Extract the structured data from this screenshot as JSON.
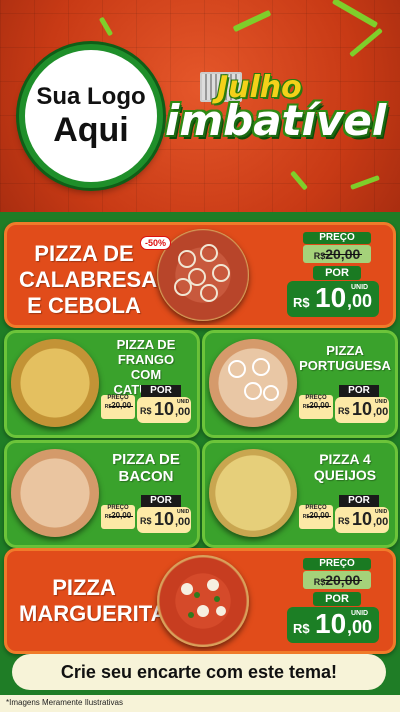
{
  "header": {
    "logo_line1": "Sua Logo",
    "logo_line2": "Aqui",
    "promo_line1": "Julho",
    "promo_line2": "imbatível"
  },
  "featured_top": {
    "name_l1": "PIZZA DE",
    "name_l2": "CALABRESA",
    "name_l3": "E CEBOLA",
    "discount": "-50%",
    "price_label": "PREÇO",
    "old_currency": "R$",
    "old_price": "20,00",
    "por_label": "POR",
    "new_currency": "R$",
    "new_price_int": "10",
    "new_price_dec": ",00",
    "unit": "UNID"
  },
  "grid": [
    {
      "name_l1": "PIZZA DE",
      "name_l2": "FRANGO COM",
      "name_l3": "CATUPIRY",
      "price_label": "PREÇO",
      "old_currency": "R$",
      "old_price": "20,00",
      "por_label": "POR",
      "new_currency": "R$",
      "new_price_int": "10",
      "new_price_dec": ",00",
      "unit": "UNID"
    },
    {
      "name_l1": "PIZZA",
      "name_l2": "PORTUGUESA",
      "name_l3": "",
      "price_label": "PREÇO",
      "old_currency": "R$",
      "old_price": "20,00",
      "por_label": "POR",
      "new_currency": "R$",
      "new_price_int": "10",
      "new_price_dec": ",00",
      "unit": "UNID"
    },
    {
      "name_l1": "PIZZA DE",
      "name_l2": "BACON",
      "name_l3": "",
      "price_label": "PREÇO",
      "old_currency": "R$",
      "old_price": "20,00",
      "por_label": "POR",
      "new_currency": "R$",
      "new_price_int": "10",
      "new_price_dec": ",00",
      "unit": "UNID"
    },
    {
      "name_l1": "PIZZA 4",
      "name_l2": "QUEIJOS",
      "name_l3": "",
      "price_label": "PREÇO",
      "old_currency": "R$",
      "old_price": "20,00",
      "por_label": "POR",
      "new_currency": "R$",
      "new_price_int": "10",
      "new_price_dec": ",00",
      "unit": "UNID"
    }
  ],
  "featured_bottom": {
    "name_l1": "PIZZA",
    "name_l2": "MARGUERITA",
    "price_label": "PREÇO",
    "old_currency": "R$",
    "old_price": "20,00",
    "por_label": "POR",
    "new_currency": "R$",
    "new_price_int": "10",
    "new_price_dec": ",00",
    "unit": "UNID"
  },
  "footer": {
    "cta": "Crie seu encarte com este tema!",
    "disclaimer": "*Imagens Meramente Ilustrativas"
  },
  "colors": {
    "orange": "#e14c1a",
    "green": "#3aa22c",
    "dark_green": "#1c7f25",
    "cream": "#f7f3d8"
  }
}
